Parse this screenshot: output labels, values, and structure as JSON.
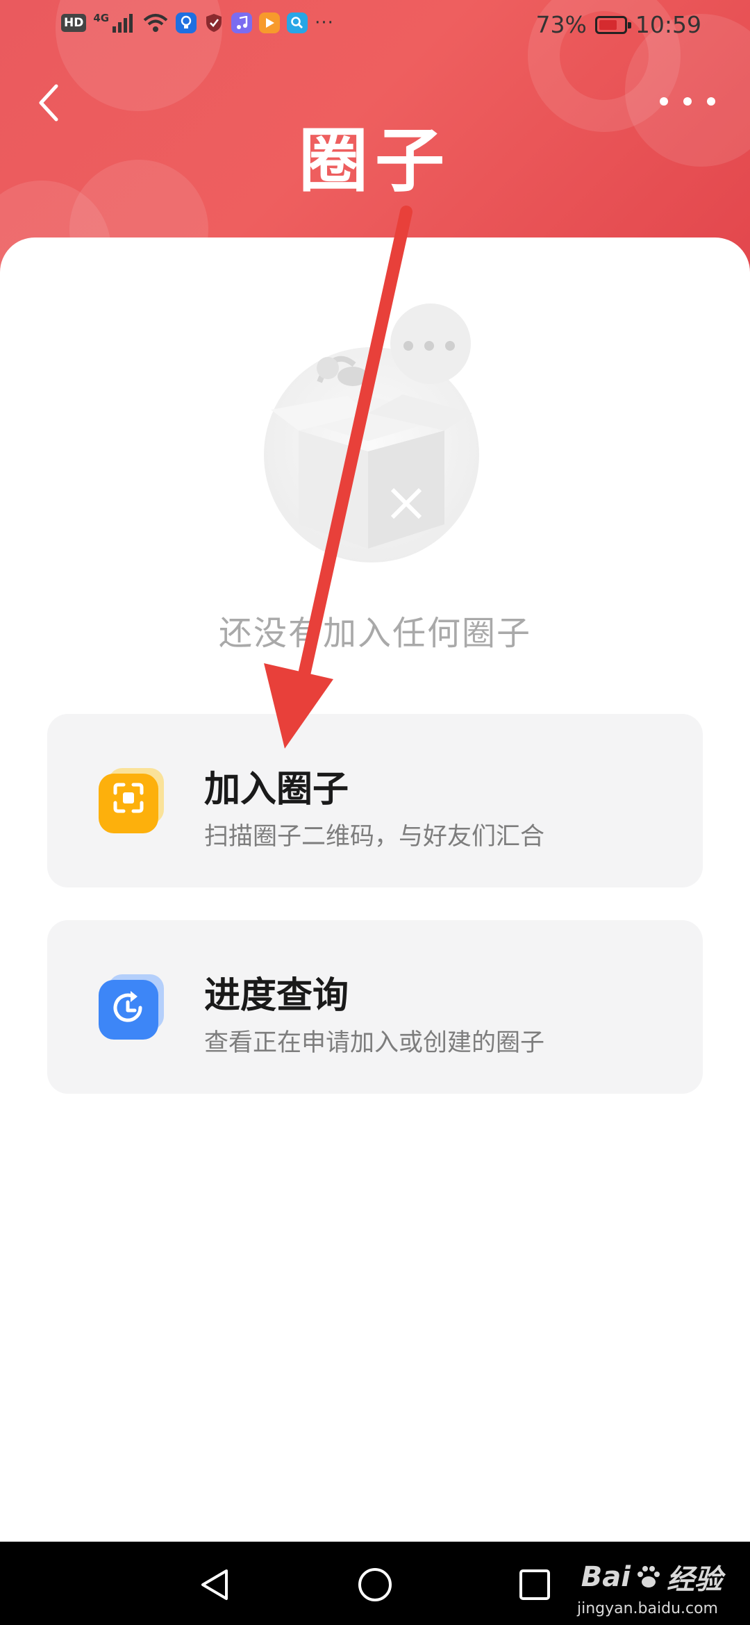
{
  "status_bar": {
    "hd": "HD",
    "network": "4G",
    "battery_percent": "73%",
    "battery_level": 0.73,
    "time": "10:59",
    "app_icons": [
      "bulb-icon",
      "shield-icon",
      "music-icon",
      "play-icon",
      "search-app-icon"
    ],
    "more": "···"
  },
  "header": {
    "title": "圈子"
  },
  "empty_state": {
    "message": "还没有加入任何圈子"
  },
  "cards": [
    {
      "title": "加入圈子",
      "subtitle": "扫描圈子二维码，与好友们汇合",
      "icon": "scan-qr-icon",
      "accent": "#fdb00c"
    },
    {
      "title": "进度查询",
      "subtitle": "查看正在申请加入或创建的圈子",
      "icon": "progress-refresh-icon",
      "accent": "#3d86f7"
    }
  ],
  "colors": {
    "header_red": "#ea5a5e",
    "annotation_arrow": "#e8403a"
  },
  "watermark": {
    "brand": "Bai",
    "brand_suffix": "经验",
    "url": "jingyan.baidu.com"
  }
}
